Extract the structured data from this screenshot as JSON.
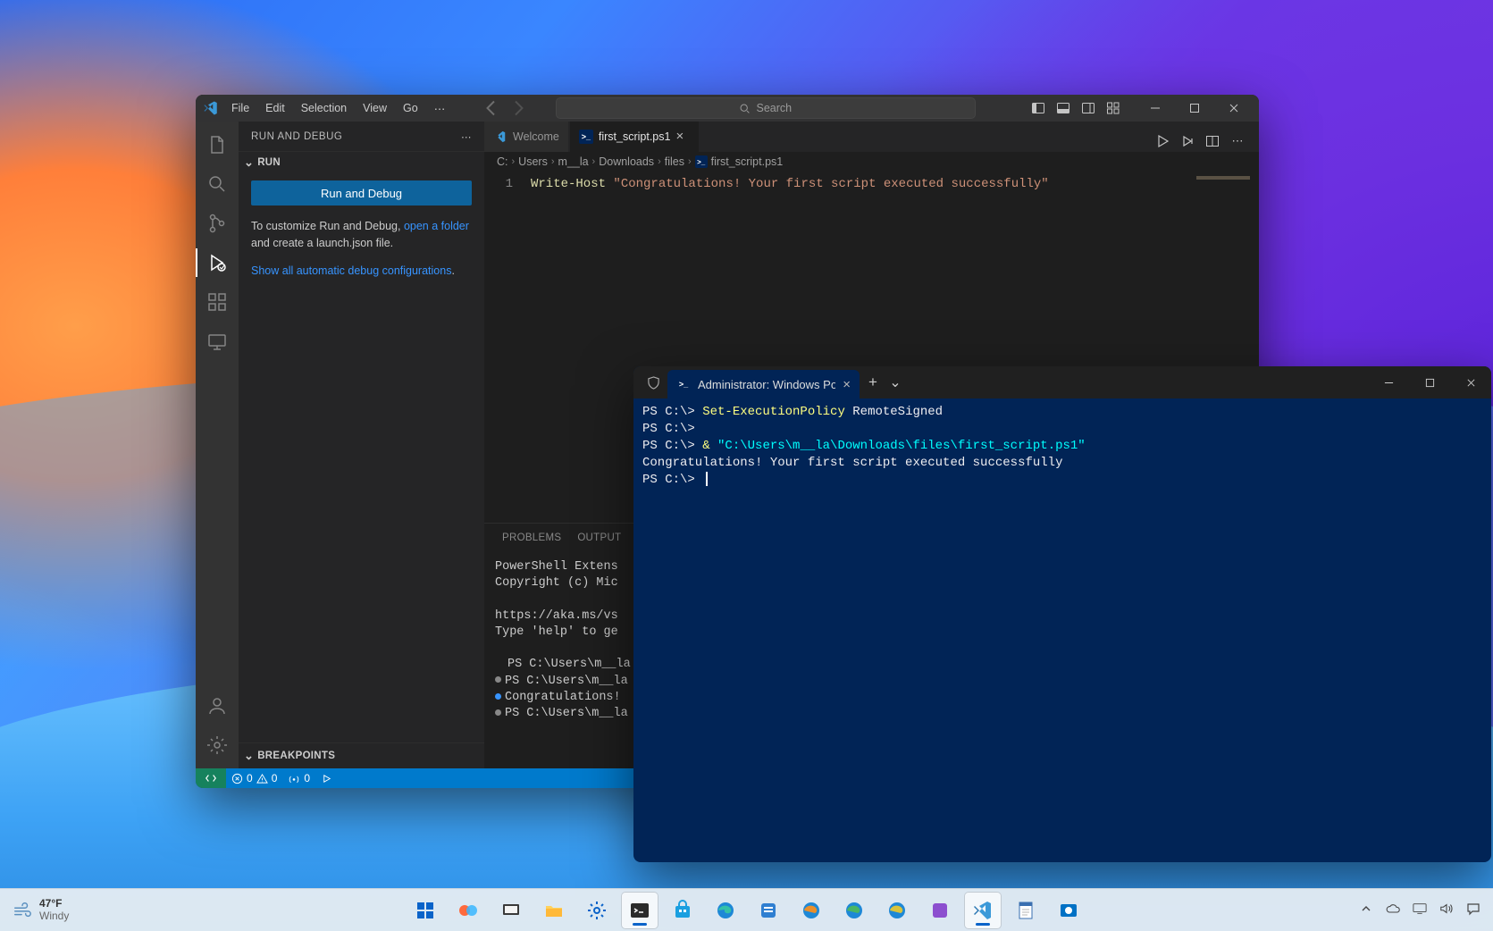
{
  "vscode": {
    "menu": [
      "File",
      "Edit",
      "Selection",
      "View",
      "Go"
    ],
    "menu_more": "⋯",
    "search_placeholder": "Search",
    "sidebar": {
      "title": "RUN AND DEBUG",
      "run_section": "RUN",
      "run_button": "Run and Debug",
      "customize_pre": "To customize Run and Debug, ",
      "customize_link": "open a folder",
      "customize_post": " and create a launch.json file.",
      "show_configs": "Show all automatic debug configurations",
      "breakpoints": "BREAKPOINTS"
    },
    "tabs": [
      {
        "label": "Welcome",
        "icon": "vs",
        "active": false
      },
      {
        "label": "first_script.ps1",
        "icon": "ps",
        "active": true
      }
    ],
    "breadcrumbs": [
      "C:",
      "Users",
      "m__la",
      "Downloads",
      "files",
      "first_script.ps1"
    ],
    "editor": {
      "line_no": "1",
      "cmd": "Write-Host ",
      "str": "\"Congratulations! Your first script executed successfully\""
    },
    "panel": {
      "tabs": [
        "PROBLEMS",
        "OUTPUT"
      ],
      "lines": [
        "PowerShell Extens",
        "Copyright (c) Mic",
        "",
        "https://aka.ms/vs",
        "Type 'help' to ge",
        ""
      ],
      "marked_lines": [
        {
          "dot": "",
          "text": "PS C:\\Users\\m__la"
        },
        {
          "dot": "gray",
          "text": "PS C:\\Users\\m__la"
        },
        {
          "dot": "blue",
          "text": "Congratulations! "
        },
        {
          "dot": "gray",
          "text": "PS C:\\Users\\m__la"
        }
      ]
    },
    "statusbar": {
      "errors": "0",
      "warnings": "0",
      "ports": "0"
    }
  },
  "powershell": {
    "tab_title": "Administrator: Windows Powe",
    "lines": [
      {
        "prompt": "PS C:\\> ",
        "cmd": "Set-ExecutionPolicy",
        "rest": " RemoteSigned"
      },
      {
        "prompt": "PS C:\\>",
        "cmd": "",
        "rest": ""
      },
      {
        "prompt": "PS C:\\> ",
        "op": "& ",
        "string": "\"C:\\Users\\m__la\\Downloads\\files\\first_script.ps1\""
      },
      {
        "plain": "Congratulations! Your first script executed successfully"
      },
      {
        "prompt": "PS C:\\> ",
        "cursor": true
      }
    ]
  },
  "taskbar": {
    "temp": "47°F",
    "cond": "Windy"
  }
}
